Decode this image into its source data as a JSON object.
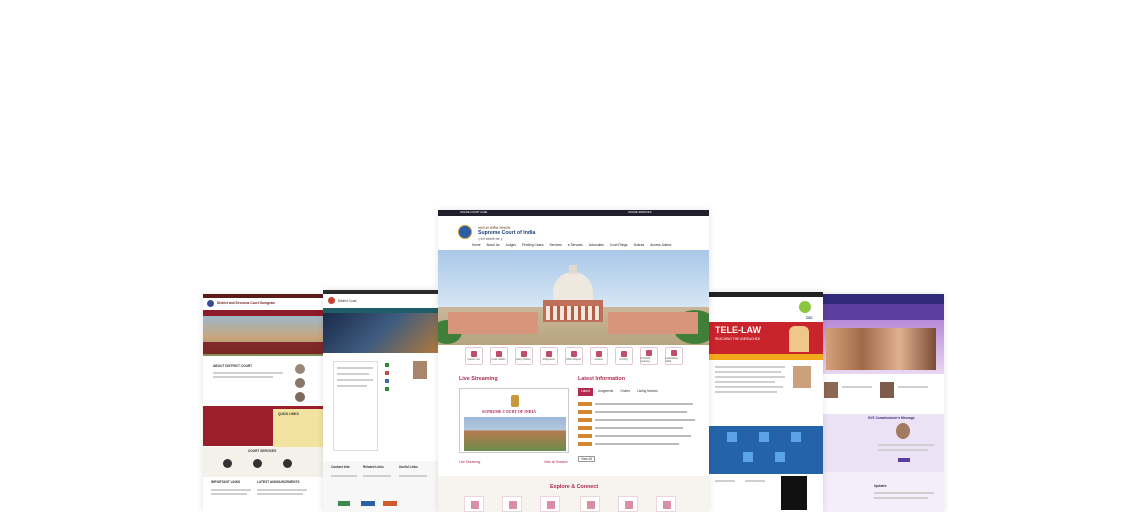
{
  "faint_heading": "",
  "center": {
    "top_left": "ONLINE COURT CASE",
    "top_right": "ONLINE SERVICES",
    "header_small": "भारत का सर्वोच्च न्यायालय",
    "title": "Supreme Court of India",
    "subtitle": "|| यतो धर्मस्ततो जयः ||",
    "nav": [
      "Home",
      "About Us",
      "Judges",
      "Pending Cases",
      "Services",
      "e-Services",
      "Advocates",
      "Court Filings",
      "Notices",
      "Access Justice"
    ],
    "quick_links": [
      "Cause List",
      "Case Status",
      "Daily Orders",
      "Judgments",
      "Office Report",
      "Caveat",
      "e-Filing",
      "Physical Hearing",
      "Hackathon 2024"
    ],
    "live_streaming_title": "Live Streaming",
    "video_caption": "SUPREME COURT OF INDIA",
    "latest_info_title": "Latest Information",
    "latest_tabs": [
      "Latest",
      "Judgments",
      "Orders",
      "Listing Notices"
    ],
    "view_all": "View All",
    "live_link": "Live Streaming",
    "view_all_link": "View all Streams",
    "explore_title": "Explore & Connect"
  },
  "left1": {
    "title": "District and Sessions Court Gurugram",
    "about": "ABOUT DISTRICT COURT",
    "quick_links": "QUICK LINKS",
    "services": "COURT SERVICES",
    "important": "IMPORTANT LINKS",
    "latest": "LATEST ANNOUNCEMENTS"
  },
  "left2": {
    "title": "District Court",
    "col1": "Contact Info",
    "col2": "Related Links",
    "col3": "Useful Links"
  },
  "right1": {
    "banner": "TELE-LAW",
    "banner_sub": "REACHING THE UNREACHED",
    "logo": "CSC"
  },
  "right2": {
    "title": "KVS Commissioner's Message",
    "section": "Updates"
  },
  "colors": {
    "accent": "#b3294e",
    "navy": "#1f1f2e",
    "teal": "#1f5e66",
    "maroon": "#8e1b2a",
    "blue": "#2563a8",
    "purple": "#5b3fa0"
  }
}
